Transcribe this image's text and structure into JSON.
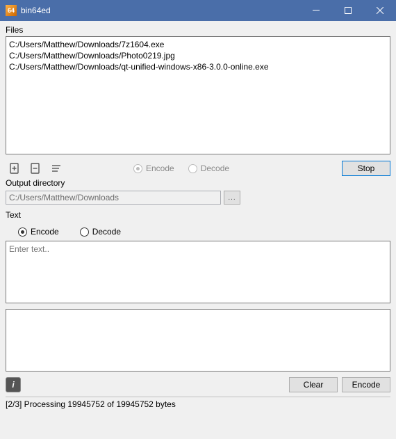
{
  "window": {
    "title": "bin64ed",
    "icon_text": "64"
  },
  "files": {
    "label": "Files",
    "items": [
      "C:/Users/Matthew/Downloads/7z1604.exe",
      "C:/Users/Matthew/Downloads/Photo0219.jpg",
      "C:/Users/Matthew/Downloads/qt-unified-windows-x86-3.0.0-online.exe"
    ]
  },
  "file_mode": {
    "encode": "Encode",
    "decode": "Decode"
  },
  "buttons": {
    "stop": "Stop",
    "clear": "Clear",
    "encode": "Encode",
    "browse": "..."
  },
  "outdir": {
    "label": "Output directory",
    "value": "C:/Users/Matthew/Downloads"
  },
  "text": {
    "label": "Text",
    "encode": "Encode",
    "decode": "Decode",
    "placeholder": "Enter text.."
  },
  "status": "[2/3] Processing 19945752 of 19945752 bytes"
}
